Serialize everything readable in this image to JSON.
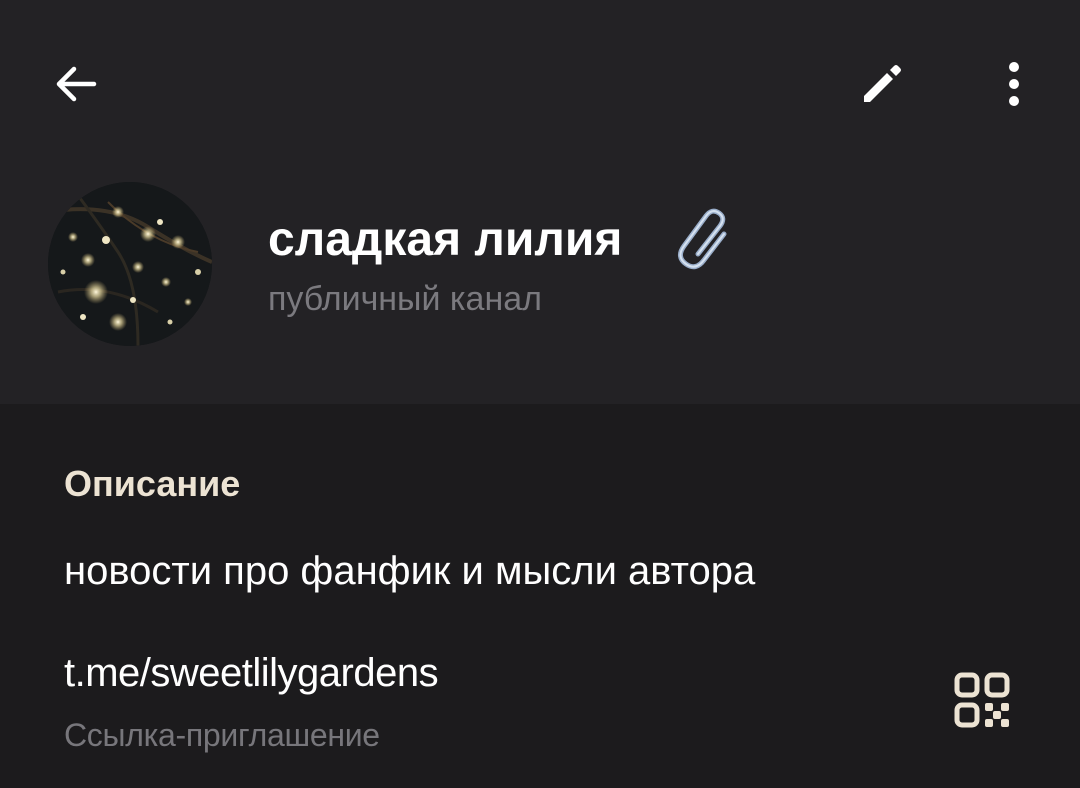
{
  "toolbar": {
    "back_icon": "arrow-left-icon",
    "edit_icon": "pencil-icon",
    "more_icon": "more-vertical-icon"
  },
  "profile": {
    "name": "сладкая лилия",
    "name_emoji_icon": "paperclip-icon",
    "subtitle": "публичный канал",
    "avatar": "night-blossom-lights-photo"
  },
  "info": {
    "section_title": "Описание",
    "description": "новости про фанфик и мысли автора",
    "link": "t.me/sweetlilygardens",
    "link_caption": "Ссылка-приглашение",
    "qr_icon": "qr-code-icon"
  },
  "colors": {
    "header_bg": "#232225",
    "page_bg": "#1c1b1d",
    "section_title": "#ece3d3",
    "secondary_text": "#7b7a7f"
  }
}
